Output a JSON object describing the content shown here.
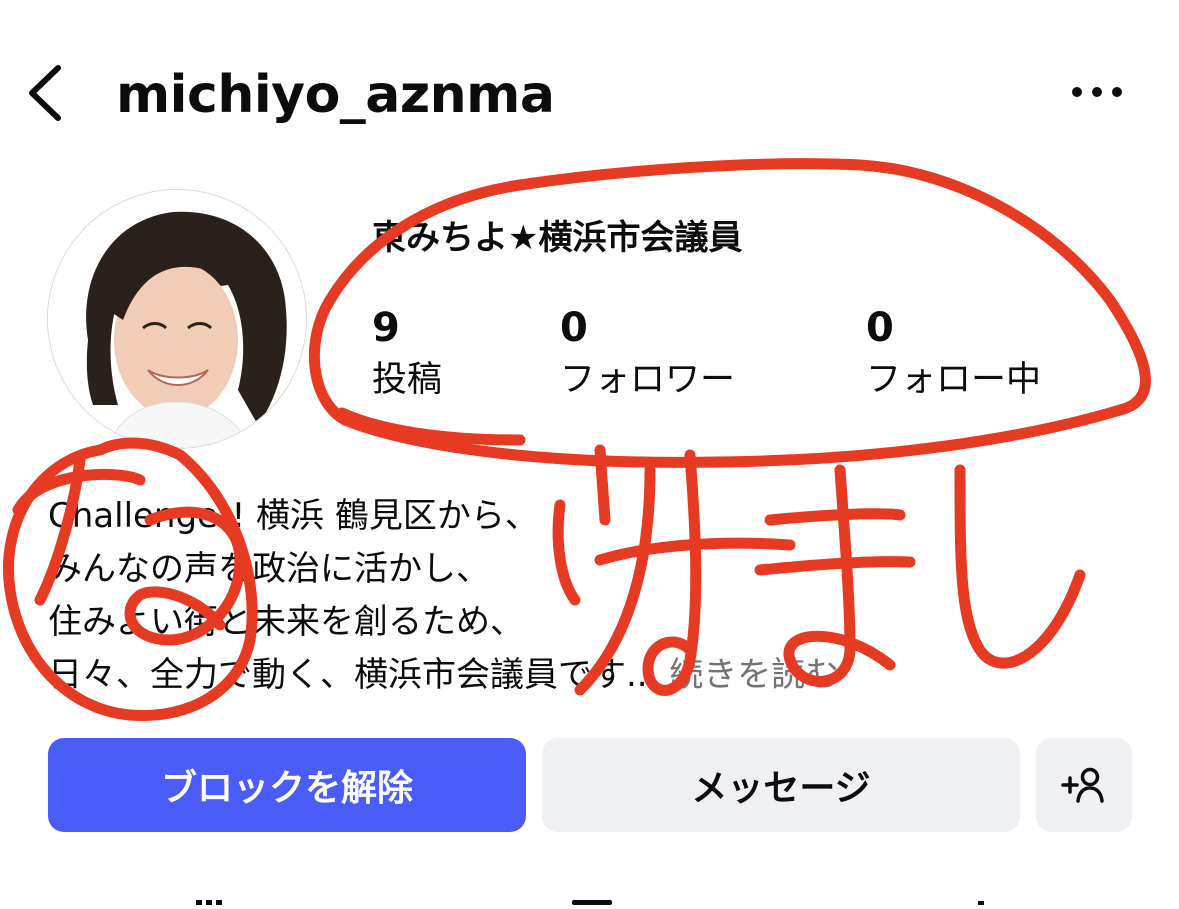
{
  "header": {
    "username": "michiyo_aznma"
  },
  "profile": {
    "display_name": "東みちよ★横浜市会議員",
    "stats": [
      {
        "value": "9",
        "label": "投稿"
      },
      {
        "value": "0",
        "label": "フォロワー"
      },
      {
        "value": "0",
        "label": "フォロー中"
      }
    ],
    "bio_lines": [
      "Challenge!! 横浜 鶴見区から、",
      "みんなの声を政治に活かし、",
      "住みよい街と未来を創るため、",
      "日々、全力で動く、横浜市会議員です..."
    ],
    "bio_more": "続きを読む"
  },
  "actions": {
    "unblock_label": "ブロックを解除",
    "message_label": "メッセージ"
  },
  "annotation": {
    "handwritten_text": "なりすまし",
    "color": "#e63a22"
  },
  "colors": {
    "primary_button": "#4a5df9",
    "secondary_button": "#eff0f3",
    "muted_text": "#737373"
  },
  "icons": {
    "back": "chevron-left-icon",
    "more": "more-horizontal-icon",
    "add_user": "add-user-icon"
  }
}
